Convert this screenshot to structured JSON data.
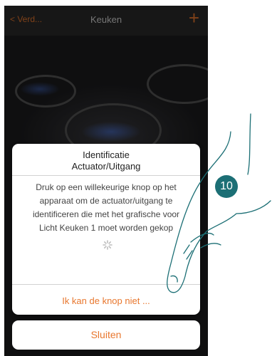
{
  "header": {
    "back_label": "< Verd...",
    "title": "Keuken",
    "add_label": "+"
  },
  "dialog": {
    "title_line1": "Identificatie",
    "title_line2": "Actuator/Uitgang",
    "body_lines": [
      "Druk op een willekeurige knop op het",
      "apparaat om de actuator/uitgang te",
      "identificeren die met het grafische voor",
      "Licht Keuken 1 moet worden gekop"
    ],
    "link_label": "Ik kan de knop niet ...",
    "close_label": "Sluiten"
  },
  "step_badge": "10",
  "colors": {
    "accent": "#e8772e",
    "badge": "#1c6f75"
  },
  "icons": [
    "chevron-left-icon",
    "plus-icon",
    "spinner-icon",
    "pointing-hand-icon"
  ]
}
